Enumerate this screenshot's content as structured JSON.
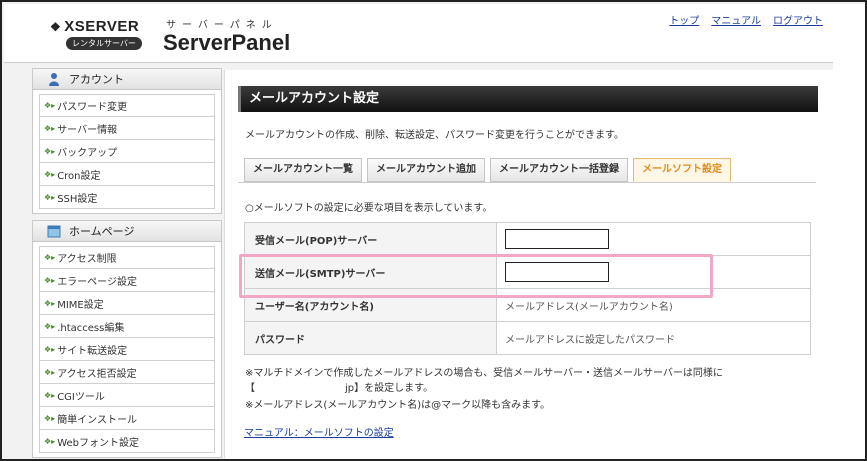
{
  "header": {
    "logo_name": "XSERVER",
    "logo_badge": "レンタルサーバー",
    "kana": "サーバーパネル",
    "title": "ServerPanel",
    "links": [
      "トップ",
      "マニュアル",
      "ログアウト"
    ]
  },
  "sidebar": {
    "account": {
      "heading": "アカウント",
      "items": [
        "パスワード変更",
        "サーバー情報",
        "バックアップ",
        "Cron設定",
        "SSH設定"
      ]
    },
    "homepage": {
      "heading": "ホームページ",
      "items": [
        "アクセス制限",
        "エラーページ設定",
        "MIME設定",
        ".htaccess編集",
        "サイト転送設定",
        "アクセス拒否設定",
        "CGIツール",
        "簡単インストール",
        "Webフォント設定"
      ]
    }
  },
  "main": {
    "title": "メールアカウント設定",
    "description": "メールアカウントの作成、削除、転送設定、パスワード変更を行うことができます。",
    "tabs": [
      {
        "label": "メールアカウント一覧",
        "active": false
      },
      {
        "label": "メールアカウント追加",
        "active": false
      },
      {
        "label": "メールアカウント一括登録",
        "active": false
      },
      {
        "label": "メールソフト設定",
        "active": true
      }
    ],
    "note": "○メールソフトの設定に必要な項目を表示しています。",
    "rows": [
      {
        "label": "受信メール(POP)サーバー",
        "value": ""
      },
      {
        "label": "送信メール(SMTP)サーバー",
        "value": ""
      },
      {
        "label": "ユーザー名(アカウント名)",
        "value": "メールアドレス(メールアカウント名)"
      },
      {
        "label": "パスワード",
        "value": "メールアドレスに設定したパスワード"
      }
    ],
    "footnote1": "※マルチドメインで作成したメールアドレスの場合も、受信メールサーバー・送信メールサーバーは同様に",
    "footnote2_open": "【",
    "footnote2_domain": "jp】を設定します。",
    "footnote3": "※メールアドレス(メールアカウント名)は@マーク以降も含みます。",
    "manual_link": "マニュアル：メールソフトの設定"
  }
}
